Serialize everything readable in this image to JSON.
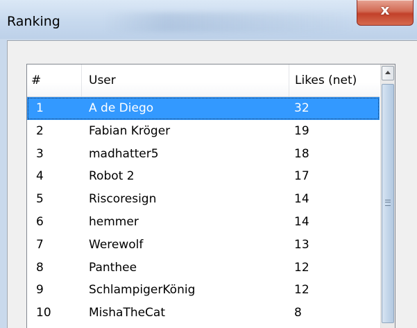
{
  "window": {
    "title": "Ranking",
    "close_glyph": "x"
  },
  "table": {
    "columns": [
      "#",
      "User",
      "Likes (net)"
    ],
    "selected_index": 0,
    "rows": [
      {
        "rank": "1",
        "user": "A de Diego",
        "likes": "32"
      },
      {
        "rank": "2",
        "user": "Fabian Kröger",
        "likes": "19"
      },
      {
        "rank": "3",
        "user": "madhatter5",
        "likes": "18"
      },
      {
        "rank": "4",
        "user": "Robot 2",
        "likes": "17"
      },
      {
        "rank": "5",
        "user": "Riscoresign",
        "likes": "14"
      },
      {
        "rank": "6",
        "user": "hemmer",
        "likes": "14"
      },
      {
        "rank": "7",
        "user": "Werewolf",
        "likes": "13"
      },
      {
        "rank": "8",
        "user": "Panthee",
        "likes": "12"
      },
      {
        "rank": "9",
        "user": "SchlampigerKönig",
        "likes": "12"
      },
      {
        "rank": "10",
        "user": "MishaTheCat",
        "likes": "8"
      }
    ]
  },
  "colors": {
    "selection": "#3399ff",
    "close_button": "#c2412a"
  },
  "icons": {
    "scroll_up": "chevron-up-icon",
    "scroll_grip": "grip-lines-icon"
  }
}
